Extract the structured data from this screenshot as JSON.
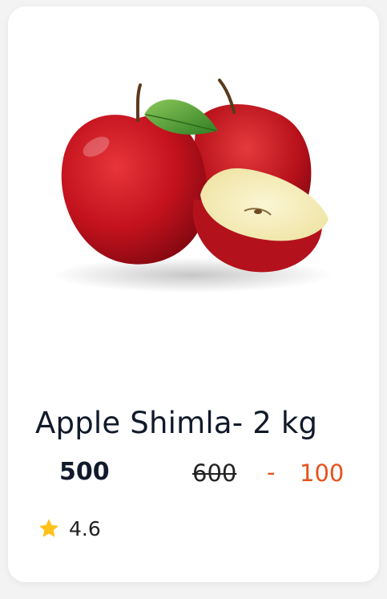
{
  "product": {
    "name": "Apple Shimla- 2 kg",
    "price": "500",
    "original_price": "600",
    "separator": "-",
    "discount": "100",
    "rating": "4.6",
    "rating_icon": "star-icon",
    "image_subject": "apples"
  },
  "colors": {
    "title": "#111a2b",
    "discount": "#e8511c",
    "star": "#ffc21a",
    "card_background": "#ffffff"
  }
}
